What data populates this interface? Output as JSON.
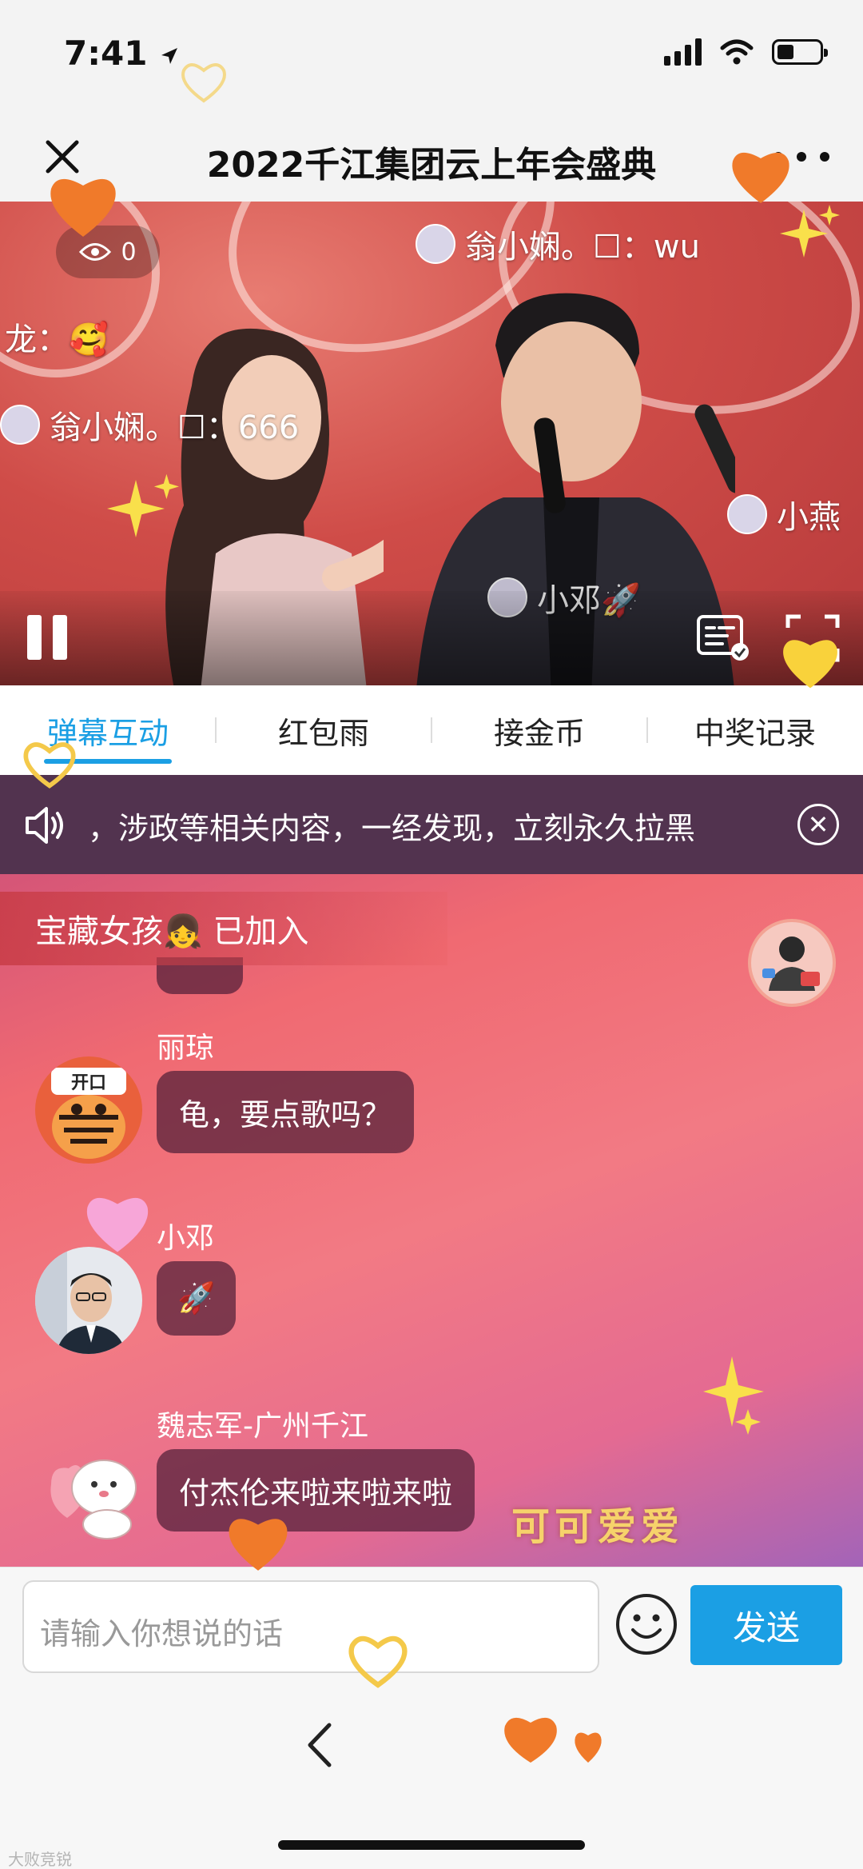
{
  "status_bar": {
    "time": "7:41"
  },
  "header": {
    "title": "2022千江集团云上年会盛典"
  },
  "video": {
    "viewer_count": "0",
    "danmu": [
      {
        "text": "翁小娴。☐：wu"
      },
      {
        "text": "龙：🥰"
      },
      {
        "text": "翁小娴。☐：666"
      },
      {
        "text": "小燕"
      },
      {
        "text": "小邓🚀"
      }
    ]
  },
  "tabs": [
    {
      "label": "弹幕互动",
      "active": true
    },
    {
      "label": "红包雨"
    },
    {
      "label": "接金币"
    },
    {
      "label": "中奖记录"
    }
  ],
  "notice": {
    "text": "，涉政等相关内容，一经发现，立刻永久拉黑"
  },
  "join_banner": {
    "text": "宝藏女孩👧 已加入"
  },
  "messages": [
    {
      "name": "丽琼",
      "text": "龟，要点歌吗？"
    },
    {
      "name": "小邓",
      "text": "🚀"
    },
    {
      "name": "魏志军-广州千江",
      "text": "付杰伦来啦来啦来啦"
    }
  ],
  "decoration_text": "可可爱爱",
  "input": {
    "placeholder": "请输入你想说的话",
    "send_label": "发送"
  },
  "watermark": "大败竞锐",
  "colors": {
    "accent": "#1b9fe4",
    "notice_bg": "#52334f",
    "bubble_bg": "rgba(80,30,55,0.72)"
  }
}
